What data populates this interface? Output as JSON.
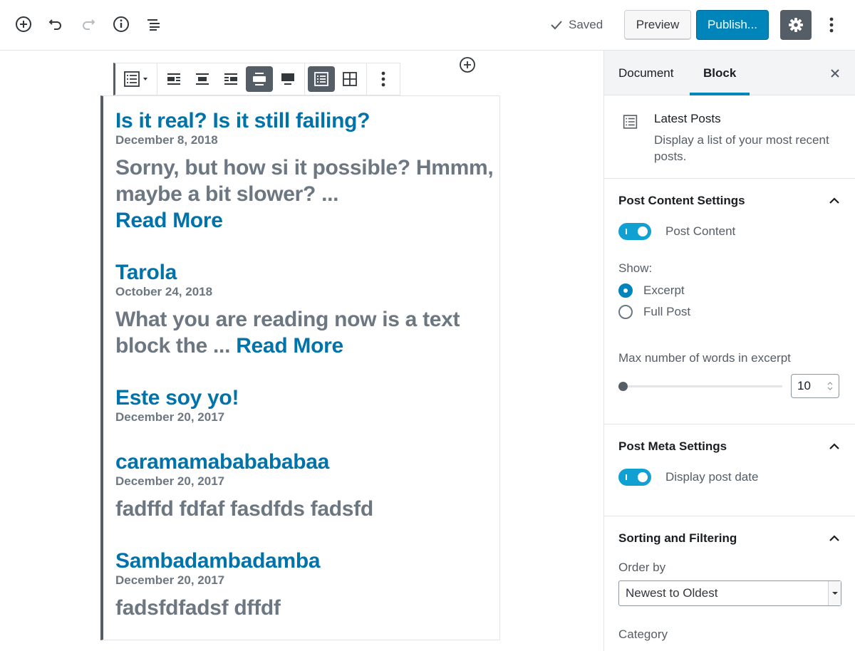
{
  "header": {
    "saved_label": "Saved",
    "preview_label": "Preview",
    "publish_label": "Publish...",
    "icons": [
      "add-block-icon",
      "undo-icon",
      "redo-icon",
      "info-icon",
      "outline-icon",
      "check-icon",
      "gear-icon",
      "more-vertical-icon"
    ]
  },
  "toolbar": {
    "icons": [
      "latest-posts-icon",
      "align-left-icon",
      "align-center-icon",
      "align-right-icon",
      "align-wide-icon",
      "align-full-icon",
      "list-view-icon",
      "grid-view-icon",
      "more-vertical-icon"
    ]
  },
  "posts": [
    {
      "title": "Is it real? Is it still failing?",
      "date": "December 8, 2018",
      "excerpt": "Sorny, but how si it possible? Hmmm, maybe a bit slower? ...",
      "read_more": "Read More"
    },
    {
      "title": "Tarola",
      "date": "October 24, 2018",
      "excerpt": "What you are reading now is a text block the ...",
      "read_more": "Read More"
    },
    {
      "title": "Este soy yo!",
      "date": "December 20, 2017",
      "excerpt": "",
      "read_more": ""
    },
    {
      "title": "caramamababababaa",
      "date": "December 20, 2017",
      "excerpt": "fadffd fdfaf fasdfds fadsfd",
      "read_more": ""
    },
    {
      "title": "Sambadambadamba",
      "date": "December 20, 2017",
      "excerpt": "fadsfdfadsf dffdf",
      "read_more": ""
    }
  ],
  "sidebar": {
    "tabs": [
      {
        "label": "Document"
      },
      {
        "label": "Block"
      }
    ],
    "active_tab": "Block",
    "block_card": {
      "title": "Latest Posts",
      "description": "Display a list of your most recent posts."
    },
    "post_content": {
      "heading": "Post Content Settings",
      "toggle_label": "Post Content",
      "toggle_on": true,
      "show_label": "Show:",
      "options": [
        {
          "label": "Excerpt",
          "checked": true
        },
        {
          "label": "Full Post",
          "checked": false
        }
      ],
      "max_words_label": "Max number of words in excerpt",
      "max_words_value": "10",
      "slider_fraction": 0.0
    },
    "post_meta": {
      "heading": "Post Meta Settings",
      "toggle_label": "Display post date",
      "toggle_on": true
    },
    "sorting": {
      "heading": "Sorting and Filtering",
      "order_label": "Order by",
      "order_value": "Newest to Oldest",
      "category_label": "Category"
    }
  },
  "colors": {
    "accent": "#0085ba",
    "link": "#0073aa",
    "toggle": "#11a0d2",
    "text_muted": "#6c7781"
  }
}
